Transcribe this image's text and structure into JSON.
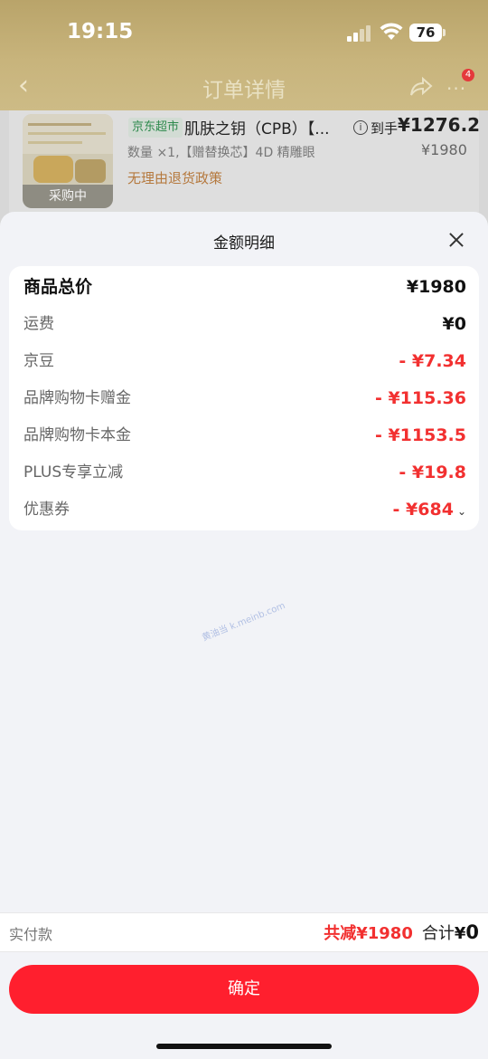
{
  "status_bar": {
    "time": "19:15",
    "battery": "76"
  },
  "nav": {
    "title": "订单详情",
    "badge": "4"
  },
  "product": {
    "store_tag": "京东超市",
    "name": "肌肤之钥（CPB）【...",
    "arrive_label": "到手",
    "arrive_price": "¥1276.2",
    "original_price": "¥1980",
    "quantity_line": "数量 ×1,【赠替换芯】4D 精雕眼",
    "return_policy": "无理由退货政策",
    "thumb_label": "采购中"
  },
  "sheet": {
    "title": "金额明细",
    "rows": [
      {
        "label": "商品总价",
        "value": "¥1980",
        "style": "total"
      },
      {
        "label": "运费",
        "value": "¥0",
        "style": "normal"
      },
      {
        "label": "京豆",
        "value": "- ¥7.34",
        "style": "discount"
      },
      {
        "label": "品牌购物卡赠金",
        "value": "- ¥115.36",
        "style": "discount"
      },
      {
        "label": "品牌购物卡本金",
        "value": "- ¥1153.5",
        "style": "discount"
      },
      {
        "label": "PLUS专享立减",
        "value": "- ¥19.8",
        "style": "discount"
      },
      {
        "label": "优惠券",
        "value": "- ¥684",
        "style": "discount"
      }
    ],
    "watermark": "黄油当 k.meinb.com"
  },
  "bottom": {
    "actual_label": "实付款",
    "reduce_text": "共减¥1980",
    "sum_label": "合计",
    "sum_currency": "¥",
    "sum_value": "0"
  },
  "confirm_label": "确定",
  "colors": {
    "accent": "#ff1f2e",
    "discount_red": "#f23030"
  }
}
